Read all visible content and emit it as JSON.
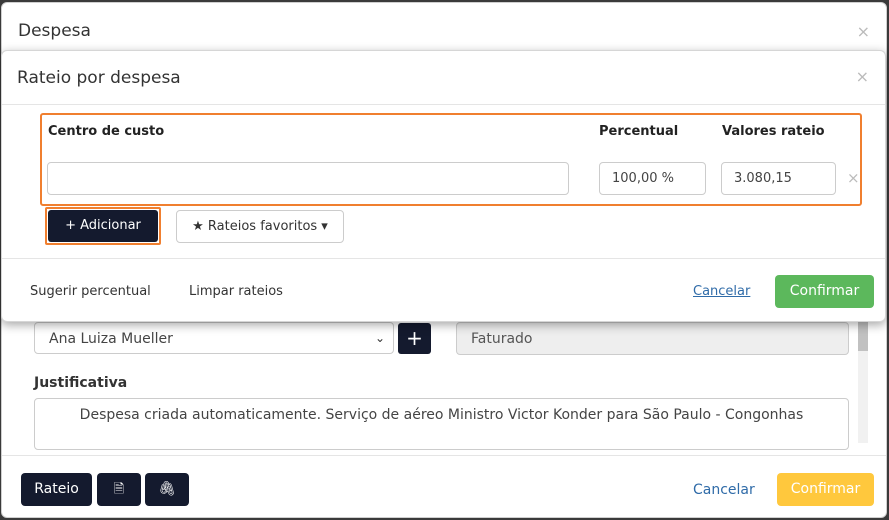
{
  "outer_modal": {
    "title": "Despesa",
    "close_glyph": "×",
    "form": {
      "select_value": "Ana Luiza Mueller",
      "select_caret": "⌄",
      "plus_label": "+",
      "status_value": "Faturado",
      "justification_label": "Justificativa",
      "justification_value": "Despesa criada automaticamente. Serviço de aéreo Ministro Victor Konder para São Paulo - Congonhas"
    },
    "footer": {
      "rateio_label": "Rateio",
      "doc_icon": "document-icon",
      "doc_glyph": "🗎",
      "clip_icon": "paperclip-icon",
      "clip_glyph": "🖇",
      "cancel_label": "Cancelar",
      "confirm_label": "Confirmar"
    }
  },
  "inner_modal": {
    "title": "Rateio por despesa",
    "close_glyph": "×",
    "columns": {
      "cost_center": "Centro de custo",
      "percent": "Percentual",
      "values": "Valores rateio"
    },
    "row": {
      "cost_center_value": "",
      "percent_value": "100,00 %",
      "amount_value": "3.080,15",
      "remove_glyph": "×"
    },
    "add_label": "+  Adicionar",
    "favorites_label": "★ Rateios favoritos ▾",
    "footer": {
      "suggest_label": "Sugerir percentual",
      "clear_label": "Limpar rateios",
      "cancel_label": "Cancelar",
      "confirm_label": "Confirmar"
    }
  },
  "colors": {
    "highlight": "#f07f2f",
    "dark_button": "#141a2e",
    "confirm_green": "#5cb85c",
    "confirm_yellow": "#ffc83d",
    "link_blue": "#2f6ba8"
  }
}
